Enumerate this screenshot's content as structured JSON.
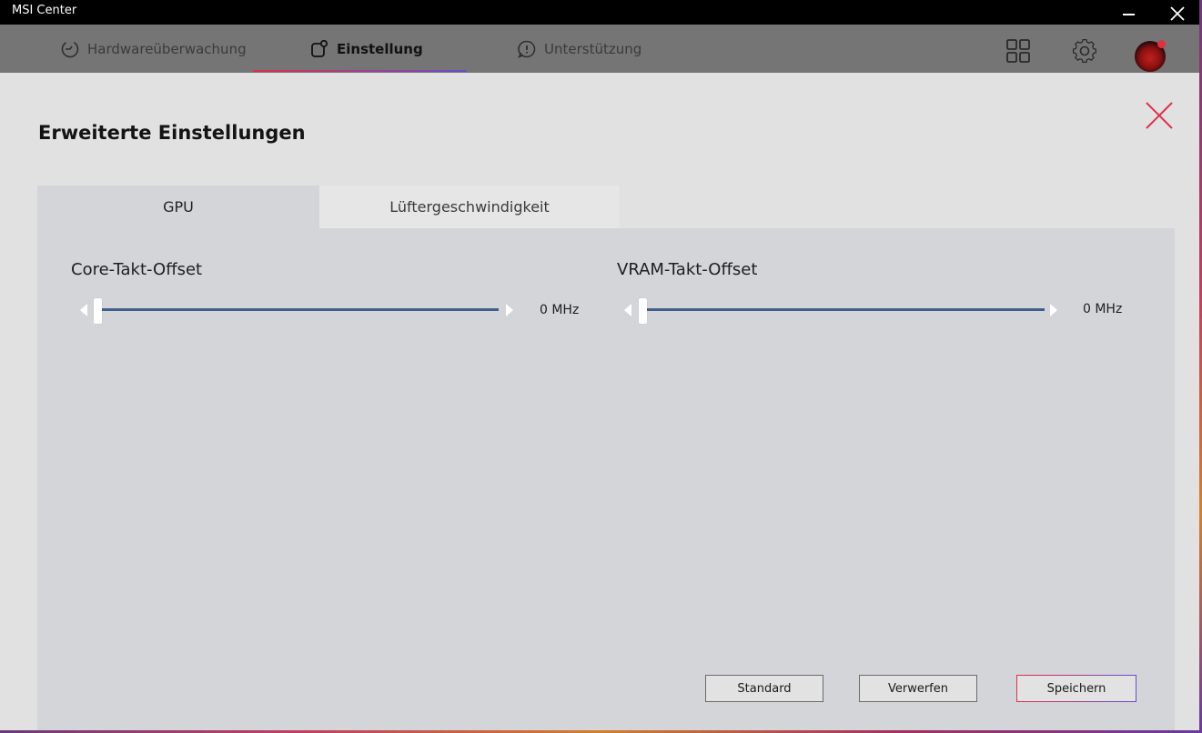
{
  "window": {
    "title": "MSI Center"
  },
  "nav": {
    "tabs": [
      {
        "label": "Hardwareüberwachung",
        "icon": "monitor-gauge-icon"
      },
      {
        "label": "Einstellung",
        "icon": "settings-square-icon",
        "active": true
      },
      {
        "label": "Unterstützung",
        "icon": "support-alert-icon"
      }
    ],
    "accent_gradient": [
      "#e0304a",
      "#6a4ad0"
    ]
  },
  "page": {
    "title": "Erweiterte Einstellungen"
  },
  "tabs": [
    {
      "label": "GPU",
      "active": true
    },
    {
      "label": "Lüftergeschwindigkeit",
      "active": false
    }
  ],
  "sliders": [
    {
      "label": "Core-Takt-Offset",
      "value_text": "0 MHz",
      "level": 0
    },
    {
      "label": "VRAM-Takt-Offset",
      "value_text": "0 MHz",
      "level": 0
    }
  ],
  "buttons": {
    "standard": "Standard",
    "discard": "Verwerfen",
    "save": "Speichern"
  },
  "colors": {
    "track": "#3d5e8f",
    "close_x": "#e0304a"
  }
}
